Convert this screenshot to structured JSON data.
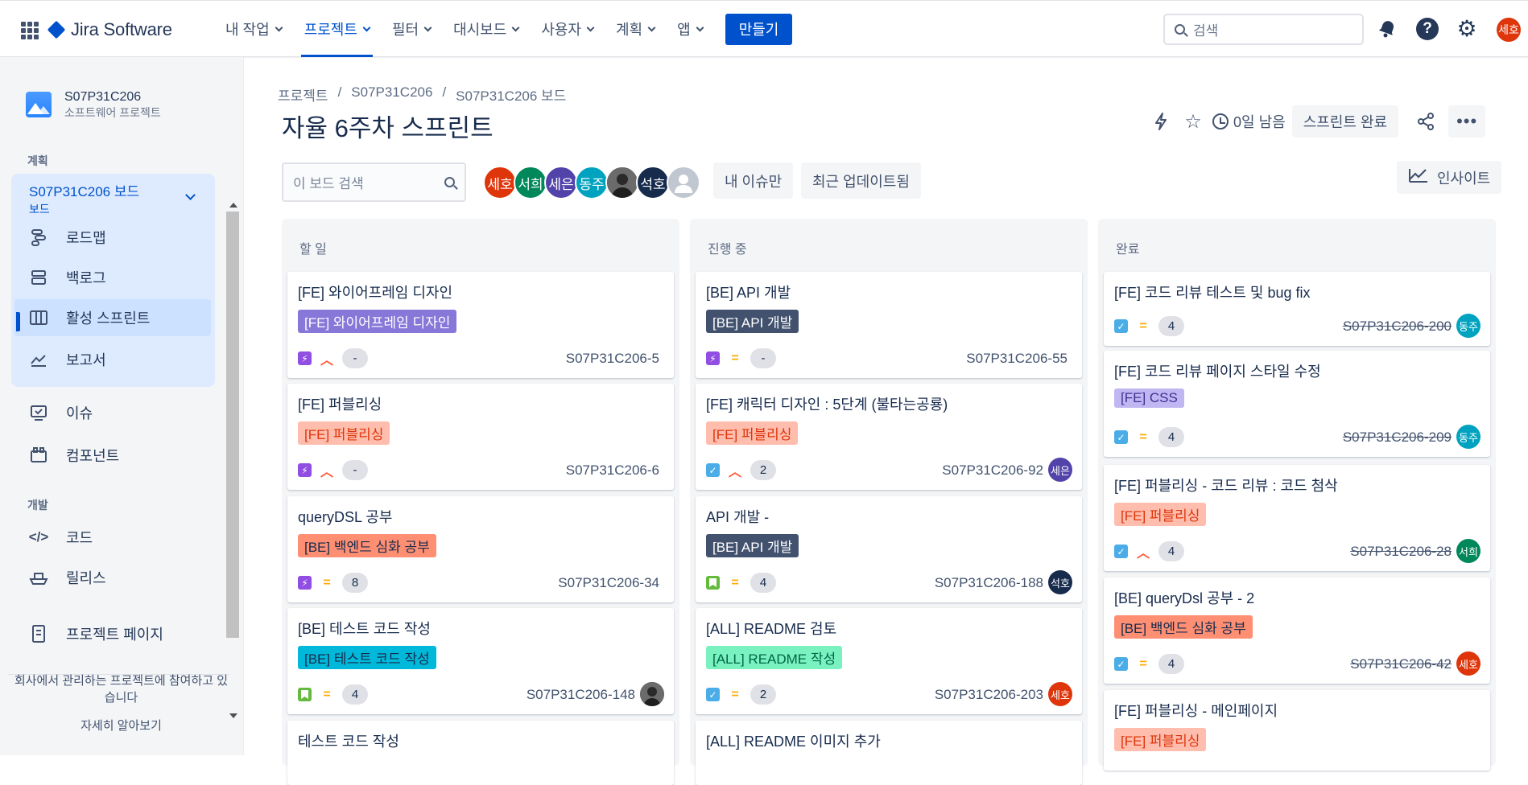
{
  "topbar": {
    "product": "Jira Software",
    "nav": [
      "내 작업",
      "프로젝트",
      "필터",
      "대시보드",
      "사용자",
      "계획",
      "앱"
    ],
    "active_nav": "프로젝트",
    "create": "만들기",
    "search_placeholder": "검색",
    "user_initials": "세호"
  },
  "sidebar": {
    "project_name": "S07P31C206",
    "project_type": "소프트웨어 프로젝트",
    "section_plan": "계획",
    "board_title": "S07P31C206 보드",
    "board_sub": "보드",
    "items": [
      "로드맵",
      "백로그",
      "활성 스프린트",
      "보고서"
    ],
    "items2": [
      "이슈",
      "컴포넌트"
    ],
    "section_dev": "개발",
    "items3": [
      "코드",
      "릴리스"
    ],
    "project_page": "프로젝트 페이지",
    "footer": "회사에서 관리하는 프로젝트에 참여하고 있습니다",
    "learn_more": "자세히 알아보기"
  },
  "header": {
    "breadcrumb": [
      "프로젝트",
      "S07P31C206",
      "S07P31C206 보드"
    ],
    "title": "자율 6주차 스프린트",
    "time_left": "0일 남음",
    "complete_sprint": "스프린트 완료"
  },
  "toolbar": {
    "search_placeholder": "이 보드 검색",
    "avatars": [
      {
        "name": "세호",
        "color": "#de350b"
      },
      {
        "name": "서희",
        "color": "#00875a"
      },
      {
        "name": "세은",
        "color": "#5243aa"
      },
      {
        "name": "동주",
        "color": "#00a3bf"
      },
      {
        "name": "",
        "color": "#4a4a4a"
      },
      {
        "name": "석호",
        "color": "#172b4d"
      },
      {
        "name": "",
        "color": "#c1c7d0"
      }
    ],
    "my_issues": "내 이슈만",
    "recent": "최근 업데이트됨",
    "insights": "인사이트"
  },
  "columns": [
    {
      "title": "할 일",
      "cards": [
        {
          "title": "[FE] 와이어프레임 디자인",
          "label": "[FE] 와이어프레임 디자인",
          "label_color": "#8777d9",
          "label_text": "#fff",
          "type": "story",
          "prio": "high",
          "est": "-",
          "key": "S07P31C206-5",
          "avatar": null,
          "done": false
        },
        {
          "title": "[FE] 퍼블리싱",
          "label": "[FE] 퍼블리싱",
          "label_color": "#ffbdad",
          "label_text": "#de350b",
          "type": "story",
          "prio": "high",
          "est": "-",
          "key": "S07P31C206-6",
          "avatar": null,
          "done": false
        },
        {
          "title": "queryDSL 공부",
          "label": "[BE] 백엔드 심화 공부",
          "label_color": "#ff8f73",
          "label_text": "#172b4d",
          "type": "story",
          "prio": "medium",
          "est": "8",
          "key": "S07P31C206-34",
          "avatar": null,
          "done": false
        },
        {
          "title": "[BE] 테스트 코드 작성",
          "label": "[BE] 테스트 코드 작성",
          "label_color": "#00b8d9",
          "label_text": "#172b4d",
          "type": "bookmark",
          "prio": "medium",
          "est": "4",
          "key": "S07P31C206-148",
          "avatar": {
            "name": "",
            "color": "#4a4a4a"
          },
          "done": false
        },
        {
          "title": "테스트 코드 작성",
          "label": "",
          "label_color": "",
          "label_text": "",
          "type": "",
          "prio": "",
          "est": "",
          "key": "",
          "avatar": null,
          "done": false
        }
      ]
    },
    {
      "title": "진행 중",
      "cards": [
        {
          "title": "[BE] API 개발",
          "label": "[BE] API 개발",
          "label_color": "#42526e",
          "label_text": "#fff",
          "type": "story",
          "prio": "medium",
          "est": "-",
          "key": "S07P31C206-55",
          "avatar": null,
          "done": false
        },
        {
          "title": "[FE] 캐릭터 디자인 : 5단계 (불타는공룡)",
          "label": "[FE] 퍼블리싱",
          "label_color": "#ffbdad",
          "label_text": "#de350b",
          "type": "task",
          "prio": "high",
          "est": "2",
          "key": "S07P31C206-92",
          "avatar": {
            "name": "세은",
            "color": "#5243aa"
          },
          "done": false
        },
        {
          "title": "API 개발 -",
          "label": "[BE] API 개발",
          "label_color": "#42526e",
          "label_text": "#fff",
          "type": "bookmark",
          "prio": "medium",
          "est": "4",
          "key": "S07P31C206-188",
          "avatar": {
            "name": "석호",
            "color": "#172b4d"
          },
          "done": false
        },
        {
          "title": "[ALL] README 검토",
          "label": "[ALL] README 작성",
          "label_color": "#79f2c0",
          "label_text": "#006644",
          "type": "task",
          "prio": "medium",
          "est": "2",
          "key": "S07P31C206-203",
          "avatar": {
            "name": "세호",
            "color": "#de350b"
          },
          "done": false
        },
        {
          "title": "[ALL] README 이미지 추가",
          "label": "",
          "label_color": "",
          "label_text": "",
          "type": "",
          "prio": "",
          "est": "",
          "key": "",
          "avatar": null,
          "done": false
        }
      ]
    },
    {
      "title": "완료",
      "cards": [
        {
          "title": "[FE] 코드 리뷰 테스트 및 bug fix",
          "label": "",
          "label_color": "",
          "label_text": "",
          "type": "task",
          "prio": "medium",
          "est": "4",
          "key": "S07P31C206-200",
          "avatar": {
            "name": "동주",
            "color": "#00a3bf"
          },
          "done": true
        },
        {
          "title": "[FE] 코드 리뷰 페이지 스타일 수정",
          "label": "[FE] CSS",
          "label_color": "#c0b6f2",
          "label_text": "#403294",
          "type": "task",
          "prio": "medium",
          "est": "4",
          "key": "S07P31C206-209",
          "avatar": {
            "name": "동주",
            "color": "#00a3bf"
          },
          "done": true
        },
        {
          "title": "[FE] 퍼블리싱 - 코드 리뷰 : 코드 첨삭",
          "label": "[FE] 퍼블리싱",
          "label_color": "#ffbdad",
          "label_text": "#de350b",
          "type": "task",
          "prio": "high",
          "est": "4",
          "key": "S07P31C206-28",
          "avatar": {
            "name": "서희",
            "color": "#00875a"
          },
          "done": true
        },
        {
          "title": "[BE] queryDsl 공부 - 2",
          "label": "[BE] 백엔드 심화 공부",
          "label_color": "#ff8f73",
          "label_text": "#172b4d",
          "type": "task",
          "prio": "medium",
          "est": "4",
          "key": "S07P31C206-42",
          "avatar": {
            "name": "세호",
            "color": "#de350b"
          },
          "done": true
        },
        {
          "title": "[FE] 퍼블리싱 - 메인페이지",
          "label": "[FE] 퍼블리싱",
          "label_color": "#ffbdad",
          "label_text": "#de350b",
          "type": "",
          "prio": "",
          "est": "",
          "key": "",
          "avatar": null,
          "done": false
        }
      ]
    }
  ]
}
